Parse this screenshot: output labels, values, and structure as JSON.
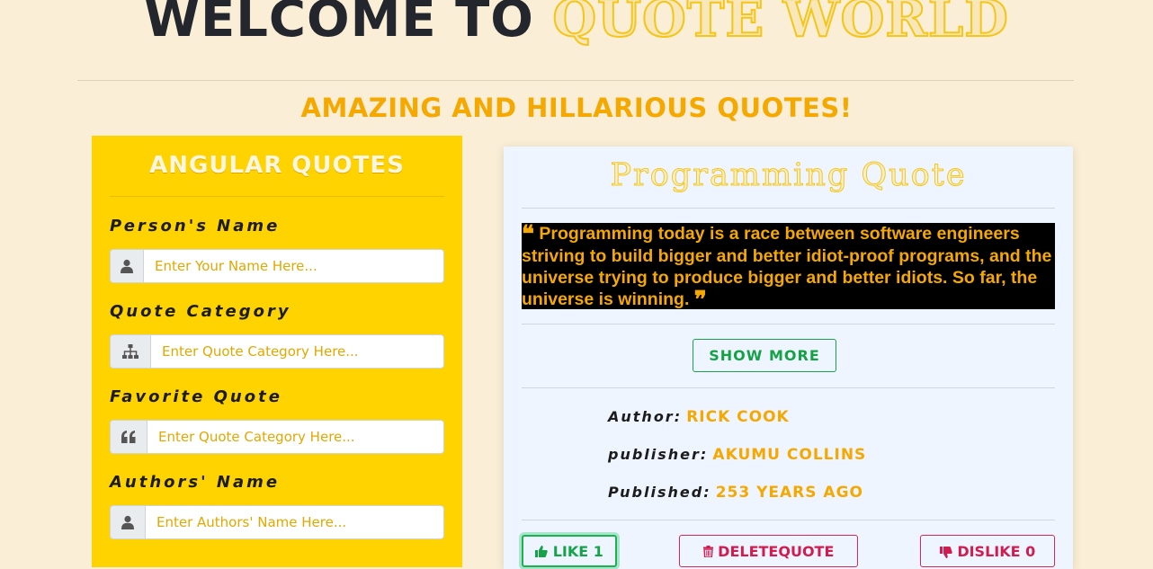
{
  "header": {
    "title_dark": "WELCOME TO",
    "title_gold": "QUOTE WORLD",
    "subtitle": "AMAZING AND HILLARIOUS QUOTES!"
  },
  "form": {
    "title": "ANGULAR QUOTES",
    "fields": [
      {
        "label": "Person's Name",
        "placeholder": "Enter Your Name Here...",
        "icon": "user-icon"
      },
      {
        "label": "Quote Category",
        "placeholder": "Enter Quote Category Here...",
        "icon": "sitemap-icon"
      },
      {
        "label": "Favorite Quote",
        "placeholder": "Enter Quote Category Here...",
        "icon": "quote-left-icon"
      },
      {
        "label": "Authors' Name",
        "placeholder": "Enter Authors' Name Here...",
        "icon": "user-icon"
      }
    ]
  },
  "card": {
    "title": "Programming Quote",
    "quote_text": "Programming today is a race between software engineers striving to build bigger and better idiot-proof programs, and the universe trying to produce bigger and better idiots. So far, the universe is winning.",
    "show_more_label": "SHOW MORE",
    "author_key": "Author:",
    "author_value": "RICK COOK",
    "publisher_key": "publisher:",
    "publisher_value": "AKUMU COLLINS",
    "published_key": "Published:",
    "published_value": "253 YEARS AGO",
    "like_label": "LIKE 1",
    "delete_label": "DELETEQUOTE",
    "dislike_label": "DISLIKE 0"
  },
  "colors": {
    "background": "#faefd6",
    "panel": "#ffd300",
    "gold": "#f5a800",
    "dark": "#23262c",
    "card": "#eef5ff",
    "like": "#17a24a",
    "danger": "#d11c4f"
  }
}
